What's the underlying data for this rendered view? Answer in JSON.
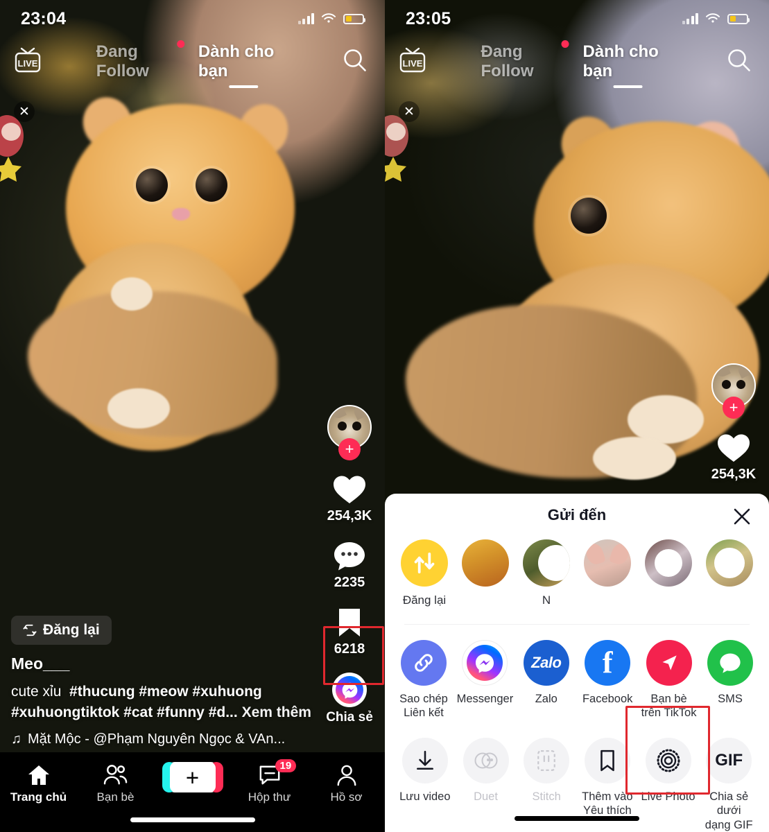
{
  "left_panel": {
    "status_bar": {
      "time": "23:04",
      "signal_icon": "cellular-signal-icon",
      "wifi_icon": "wifi-icon",
      "battery_icon": "battery-icon"
    },
    "top_nav": {
      "live_label": "LIVE",
      "tabs": [
        {
          "label": "Đang Follow",
          "active": false,
          "has_dot": true
        },
        {
          "label": "Dành cho bạn",
          "active": true,
          "has_dot": false
        }
      ],
      "search_icon": "search-icon"
    },
    "video_close_icon": "close-icon",
    "action_rail": {
      "follow_icon": "plus-icon",
      "like_count": "254,3K",
      "comment_count": "2235",
      "bookmark_count": "6218",
      "share_label": "Chia sẻ",
      "share_icon": "messenger-icon"
    },
    "caption": {
      "repost_label": "Đăng lại",
      "username": "Meo___",
      "text": "cute xỉu",
      "hashtags": "#thucung #meow #xuhuong #xuhuongtiktok #cat #funny #d...",
      "more_label": "Xem thêm",
      "music": "Mặt Mộc - @Phạm Nguyên Ngọc & VAn...",
      "music_icon": "music-note-icon",
      "disc_text": "Mặt Mộc"
    },
    "bottom_nav": [
      {
        "label": "Trang chủ",
        "icon": "home-icon",
        "active": true,
        "badge": ""
      },
      {
        "label": "Bạn bè",
        "icon": "friends-icon",
        "active": false,
        "badge": ""
      },
      {
        "label": "",
        "icon": "create-plus-icon",
        "active": false,
        "badge": ""
      },
      {
        "label": "Hộp thư",
        "icon": "inbox-icon",
        "active": false,
        "badge": "19"
      },
      {
        "label": "Hồ sơ",
        "icon": "profile-icon",
        "active": false,
        "badge": ""
      }
    ]
  },
  "right_panel": {
    "status_bar": {
      "time": "23:05"
    },
    "top_nav": {
      "live_label": "LIVE",
      "tabs": [
        {
          "label": "Đang Follow",
          "active": false,
          "has_dot": true
        },
        {
          "label": "Dành cho bạn",
          "active": true,
          "has_dot": false
        }
      ]
    },
    "video_close_icon": "close-icon",
    "action_rail": {
      "like_count": "254,3K"
    },
    "share_sheet": {
      "title": "Gửi đến",
      "close_icon": "close-icon",
      "contacts": [
        {
          "label": "Đăng lại",
          "icon": "repost-icon",
          "type": "repost"
        },
        {
          "label": "",
          "icon": "contact-avatar",
          "type": "photo1"
        },
        {
          "label": "N",
          "icon": "contact-avatar",
          "type": "photo2"
        },
        {
          "label": "",
          "icon": "contact-avatar",
          "type": "photo3"
        },
        {
          "label": "",
          "icon": "contact-avatar",
          "type": "photo4"
        },
        {
          "label": "",
          "icon": "contact-avatar",
          "type": "photo5"
        }
      ],
      "apps": [
        {
          "label": "Sao chép\nLiên kết",
          "label_l1": "Sao chép",
          "label_l2": "Liên kết",
          "icon": "link-icon"
        },
        {
          "label": "Messenger",
          "label_l1": "Messenger",
          "label_l2": "",
          "icon": "messenger-icon"
        },
        {
          "label": "Zalo",
          "label_l1": "Zalo",
          "label_l2": "",
          "icon": "zalo-icon",
          "brand_text": "Zalo"
        },
        {
          "label": "Facebook",
          "label_l1": "Facebook",
          "label_l2": "",
          "icon": "facebook-icon",
          "brand_text": "f"
        },
        {
          "label": "Bạn bè trên TikTok",
          "label_l1": "Bạn bè",
          "label_l2": "trên TikTok",
          "icon": "tiktok-friends-icon"
        },
        {
          "label": "SMS",
          "label_l1": "SMS",
          "label_l2": "",
          "icon": "sms-icon"
        }
      ],
      "actions": [
        {
          "label_l1": "Lưu video",
          "label_l2": "",
          "icon": "download-icon",
          "disabled": false,
          "highlighted": false
        },
        {
          "label_l1": "Duet",
          "label_l2": "",
          "icon": "duet-icon",
          "disabled": true,
          "highlighted": false
        },
        {
          "label_l1": "Stitch",
          "label_l2": "",
          "icon": "stitch-icon",
          "disabled": true,
          "highlighted": false
        },
        {
          "label_l1": "Thêm vào",
          "label_l2": "Yêu thích",
          "icon": "favorite-bookmark-icon",
          "disabled": false,
          "highlighted": false
        },
        {
          "label_l1": "Live Photo",
          "label_l2": "",
          "icon": "live-photo-icon",
          "disabled": false,
          "highlighted": true
        },
        {
          "label_l1": "Chia sẻ dưới",
          "label_l2": "dạng GIF",
          "icon": "gif-icon",
          "brand_text": "GIF",
          "disabled": false,
          "highlighted": false
        }
      ]
    }
  },
  "colors": {
    "tiktok_red": "#fe2c55",
    "tiktok_cyan": "#25f4ee",
    "highlight_red": "#e0282e",
    "repost_yellow": "#ffd232",
    "facebook_blue": "#1877f2",
    "zalo_blue": "#1b5fd0",
    "sms_green": "#21c14a",
    "link_purple": "#6478f0"
  }
}
